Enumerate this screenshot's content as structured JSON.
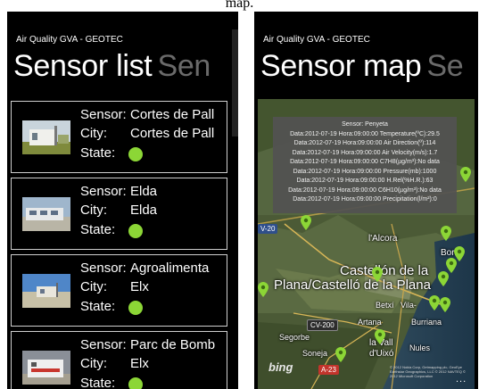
{
  "caption": "map.",
  "left_screen": {
    "app_title": "Air Quality GVA - GEOTEC",
    "pivot_title": "Sensor list",
    "pivot_next": "Sen",
    "labels": {
      "sensor": "Sensor:",
      "city": "City:",
      "state": "State:"
    },
    "sensors": [
      {
        "name": "Cortes de Pall",
        "city": "Cortes de Pall",
        "state_color": "#8cd636"
      },
      {
        "name": "Elda",
        "city": "Elda",
        "state_color": "#8cd636"
      },
      {
        "name": "Agroalimenta",
        "city": "Elx",
        "state_color": "#8cd636"
      },
      {
        "name": "Parc de Bomb",
        "city": "Elx",
        "state_color": "#8cd636"
      }
    ]
  },
  "right_screen": {
    "app_title": "Air Quality GVA - GEOTEC",
    "pivot_title": "Sensor map",
    "pivot_next": "Se",
    "popup": {
      "title": "Sensor: Penyeta",
      "lines": [
        "Data:2012-07-19 Hora:09:00:00 Temperature(ºC):29.5",
        "Data:2012-07-19 Hora:09:00:00 Air Direction(º):114",
        "Data:2012-07-19 Hora:09:00:00 Air Velocity(m/s):1.7",
        "Data:2012-07-19 Hora:09:00:00 C7H8(µg/m³):No data",
        "Data:2012-07-19 Hora:09:00:00 Pressure(mb):1000",
        "Data:2012-07-19 Hora:09:00:00 H.Rel(%H.R.):63",
        "Data:2012-07-19 Hora:09:00:00 C6H10(µg/m³):No data",
        "Data:2012-07-19 Hora:09:00:00 Precipitation(l/m²):0"
      ]
    },
    "map_labels": {
      "cv20": "V-20",
      "lalcora": "l'Alcora",
      "borriol": "Borri",
      "castello_1": "Castellón de la",
      "castello_2": "Plana/Castelló de la Plana",
      "betxi": "Betxí",
      "vila": "Vila-",
      "cv200": "CV-200",
      "artana": "Artana",
      "burriana": "Burriana",
      "segorbe": "Segorbe",
      "vall_1": "la Vall",
      "vall_2": "d'Uixó",
      "soneja": "Soneja",
      "nules": "Nules",
      "a23": "A-23",
      "bing": "bing",
      "copyright": "© 2012 Nokia Corp, Getmapping plc, GeoEye Earthstar Geographics, LLC © 2012 NAVTEQ © 2012 Microsoft Corporation",
      "appbar_dots": "..."
    },
    "marker_color": "#8cd636"
  }
}
